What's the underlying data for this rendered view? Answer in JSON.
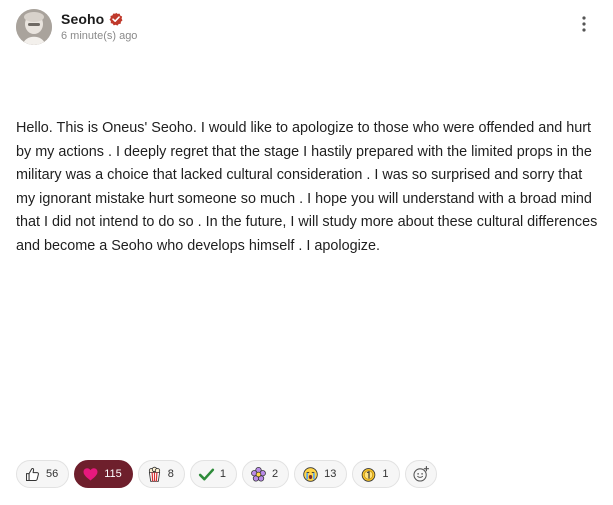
{
  "post": {
    "author": "Seoho",
    "timestamp": "6 minute(s) ago",
    "body": "Hello. This is Oneus' Seoho. I would like to apologize to those who were offended and hurt by my actions . I deeply regret that the stage I hastily prepared with the limited props in the military was a choice that lacked cultural consideration . I was so surprised and sorry that my ignorant mistake hurt someone so much . I hope you will understand with a broad mind that I did not intend to do so . In the future, I will study more about these cultural differences and become a Seoho who develops himself . I apologize."
  },
  "colors": {
    "verified_badge": "#c0392b",
    "active_reaction_bg": "#6e1f2c",
    "heart": "#e6197d"
  },
  "reactions": [
    {
      "icon": "thumbs-up-icon",
      "count": "56",
      "active": false
    },
    {
      "icon": "heart-icon",
      "count": "115",
      "active": true
    },
    {
      "icon": "popcorn-icon",
      "count": "8",
      "active": false
    },
    {
      "icon": "check-mark-icon",
      "count": "1",
      "active": false
    },
    {
      "icon": "flower-icon",
      "count": "2",
      "active": false
    },
    {
      "icon": "crying-face-icon",
      "count": "13",
      "active": false
    },
    {
      "icon": "medal-icon",
      "count": "1",
      "active": false
    }
  ],
  "add_reaction_icon": "add-emoji-icon"
}
